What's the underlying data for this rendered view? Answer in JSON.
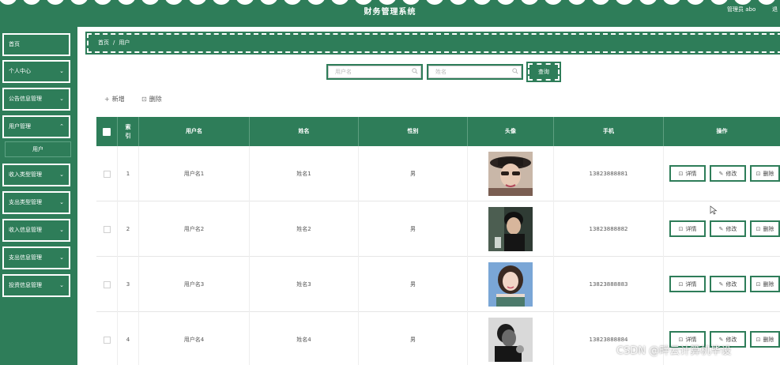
{
  "header": {
    "title": "财务管理系统",
    "user_label": "管理员 abo",
    "logout_label": "退"
  },
  "sidebar": {
    "items": [
      {
        "label": "首页",
        "has_chevron": false
      },
      {
        "label": "个人中心",
        "has_chevron": true
      },
      {
        "label": "公告信息管理",
        "has_chevron": true
      },
      {
        "label": "用户管理",
        "has_chevron": true
      },
      {
        "label": "收入类型管理",
        "has_chevron": true
      },
      {
        "label": "支出类型管理",
        "has_chevron": true
      },
      {
        "label": "收入信息管理",
        "has_chevron": true
      },
      {
        "label": "支出信息管理",
        "has_chevron": true
      },
      {
        "label": "投资信息管理",
        "has_chevron": true
      }
    ],
    "submenu": {
      "label": "用户"
    }
  },
  "breadcrumb": {
    "home": "首页",
    "separator": "/",
    "current": "用户"
  },
  "search": {
    "username_placeholder": "用户名",
    "name_placeholder": "姓名",
    "button_label": "查询"
  },
  "actions": {
    "add_icon": "+",
    "add_label": "新增",
    "delete_icon": "🗑",
    "delete_label": "删除"
  },
  "table": {
    "columns": [
      "索引",
      "用户名",
      "姓名",
      "性别",
      "头像",
      "手机",
      "操作"
    ],
    "rows": [
      {
        "index": "1",
        "username": "用户名1",
        "name": "姓名1",
        "gender": "男",
        "phone": "13823888881",
        "avatar": "avatar-woman-hat"
      },
      {
        "index": "2",
        "username": "用户名2",
        "name": "姓名2",
        "gender": "男",
        "phone": "13823888882",
        "avatar": "avatar-man-dark"
      },
      {
        "index": "3",
        "username": "用户名3",
        "name": "姓名3",
        "gender": "男",
        "phone": "13823888883",
        "avatar": "avatar-woman-blue"
      },
      {
        "index": "4",
        "username": "用户名4",
        "name": "姓名4",
        "gender": "男",
        "phone": "13823888884",
        "avatar": "avatar-man-gray"
      }
    ],
    "row_actions": {
      "detail_label": "详情",
      "edit_label": "修改",
      "delete_label": "删除"
    }
  },
  "watermark": "CSDN @畔云计算机毕设",
  "colors": {
    "primary": "#2e7d59",
    "white": "#ffffff"
  }
}
